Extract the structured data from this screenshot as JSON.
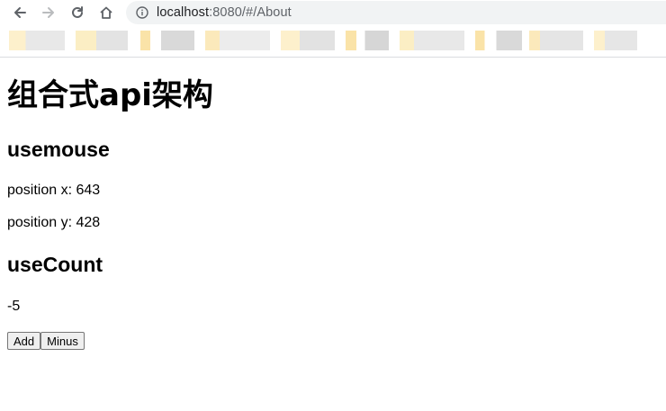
{
  "browser": {
    "url_host": "localhost",
    "url_path": ":8080/#/About",
    "bookmark_colors": [
      "#fdf0cc",
      "#e5e5e5",
      "#fae3a8",
      "#d6d6d6",
      "#ededed"
    ]
  },
  "page": {
    "title": "组合式api架构",
    "mouse_section": {
      "heading": "usemouse",
      "x_label": "position x: 643",
      "y_label": "position y: 428"
    },
    "count_section": {
      "heading": "useCount",
      "value": "-5",
      "add_label": "Add",
      "minus_label": "Minus"
    }
  }
}
